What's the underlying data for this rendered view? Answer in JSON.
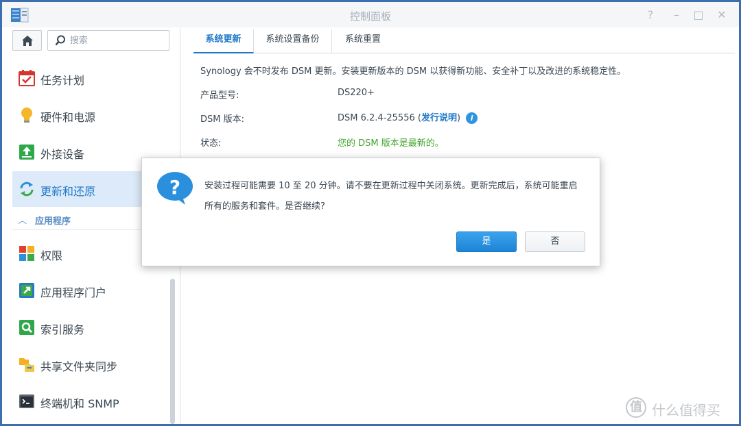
{
  "window": {
    "title": "控制面板",
    "controls": {
      "help": "?",
      "minimize": "–",
      "maximize": "□",
      "close": "✕"
    }
  },
  "sidebar": {
    "search_placeholder": "搜索",
    "items": [
      {
        "label": "任务计划",
        "icon": "calendar-check-icon"
      },
      {
        "label": "硬件和电源",
        "icon": "lightbulb-icon"
      },
      {
        "label": "外接设备",
        "icon": "external-device-icon"
      },
      {
        "label": "更新和还原",
        "icon": "update-restore-icon",
        "active": true
      }
    ],
    "section": {
      "label": "应用程序",
      "icon": "chevron-up-icon"
    },
    "app_items": [
      {
        "label": "权限",
        "icon": "privileges-icon"
      },
      {
        "label": "应用程序门户",
        "icon": "app-portal-icon"
      },
      {
        "label": "索引服务",
        "icon": "indexing-icon"
      },
      {
        "label": "共享文件夹同步",
        "icon": "folder-sync-icon"
      },
      {
        "label": "终端机和 SNMP",
        "icon": "terminal-icon"
      }
    ]
  },
  "tabs": [
    {
      "label": "系统更新",
      "active": true
    },
    {
      "label": "系统设置备份"
    },
    {
      "label": "系统重置"
    }
  ],
  "content": {
    "intro": "Synology 会不时发布 DSM 更新。安装更新版本的 DSM 以获得新功能、安全补丁以及改进的系统稳定性。",
    "rows": {
      "model_label": "产品型号:",
      "model_value": "DS220+",
      "version_label": "DSM 版本:",
      "version_value": "DSM 6.2.4-25556",
      "release_notes": "发行说明",
      "paren_open": "(",
      "paren_close": ")",
      "status_label": "状态:",
      "status_value": "您的 DSM 版本是最新的。"
    },
    "colors": {
      "status": "#43a52b",
      "link": "#1e77c8",
      "active_bg": "#dceaf9"
    }
  },
  "dialog": {
    "message_line1": "安装过程可能需要 10 至 20 分钟。请不要在更新过程中关闭系统。更新完成后，系统可能重启",
    "message_line2": "所有的服务和套件。是否继续?",
    "yes": "是",
    "no": "否"
  },
  "watermark": {
    "mark": "值",
    "text": "什么值得买"
  }
}
